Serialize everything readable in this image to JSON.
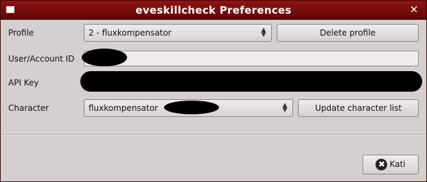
{
  "window": {
    "title": "eveskillcheck Preferences",
    "close_glyph": "✕"
  },
  "form": {
    "profile_label": "Profile",
    "profile_value": "2 - fluxkompensator",
    "delete_profile_label": "Delete profile",
    "user_id_label": "User/Account ID",
    "api_key_label": "API Key",
    "character_label": "Character",
    "character_value": "fluxkompensator",
    "update_character_list_label": "Update character list"
  },
  "footer": {
    "close_label": "Kati",
    "close_icon": "✖"
  },
  "icons": {
    "window_menu": "window-menu-icon",
    "combo_arrows": "up-down-arrows-icon",
    "close": "close-circle-icon"
  },
  "colors": {
    "titlebar": "#7a0d0d",
    "window_bg": "#d6cfcf",
    "redaction": "#000000"
  }
}
